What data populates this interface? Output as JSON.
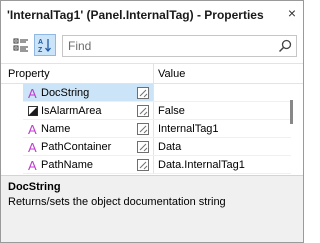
{
  "window": {
    "title": "'InternalTag1' (Panel.InternalTag) - Properties",
    "close_glyph": "×"
  },
  "toolbar": {
    "categorized_icon": "categorized-icon",
    "alphabetical_icon": "sort-az-icon",
    "alphabetical_active": true,
    "search_placeholder": "Find",
    "search_value": ""
  },
  "grid": {
    "header_property": "Property",
    "header_value": "Value",
    "rows": [
      {
        "name": "DocString",
        "value": "",
        "icon": "string-type-icon",
        "selected": true
      },
      {
        "name": "IsAlarmArea",
        "value": "False",
        "icon": "boolean-type-icon",
        "selected": false
      },
      {
        "name": "Name",
        "value": "InternalTag1",
        "icon": "string-type-icon",
        "selected": false
      },
      {
        "name": "PathContainer",
        "value": "Data",
        "icon": "string-type-icon",
        "selected": false
      },
      {
        "name": "PathName",
        "value": "Data.InternalTag1",
        "icon": "string-type-icon",
        "selected": false
      }
    ]
  },
  "description": {
    "title": "DocString",
    "text": "Returns/sets the object documentation string"
  },
  "colors": {
    "selection": "#cce4f7",
    "string_icon": "#c03ad0",
    "description_bg": "#f0f0f0"
  }
}
